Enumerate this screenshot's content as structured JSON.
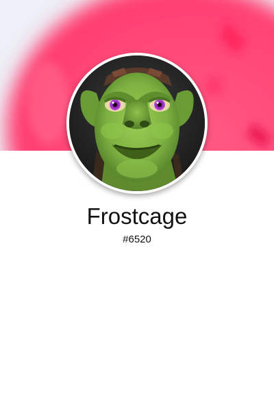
{
  "profile": {
    "name": "Frostcage",
    "tag": "#6520",
    "avatar_icon": "goblin-avatar-icon"
  },
  "colors": {
    "banner_accent": "#ff3d72",
    "banner_light": "#eef0f7",
    "page_background": "#ffffff",
    "text": "#111111",
    "avatar_skin": "#7cb041",
    "avatar_eyes": "#a82bd1"
  }
}
